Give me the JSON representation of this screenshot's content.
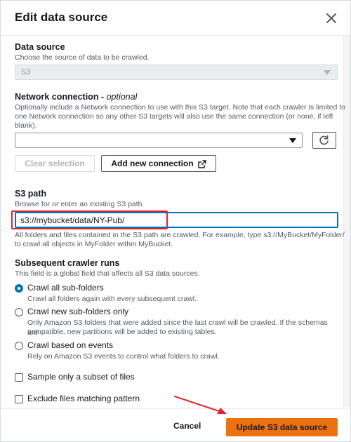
{
  "dialog": {
    "title": "Edit data source"
  },
  "data_source": {
    "label": "Data source",
    "description": "Choose the source of data to be crawled.",
    "value": "S3"
  },
  "network": {
    "label": "Network connection - ",
    "label_optional": "optional",
    "description_1": "Optionally include a Network connection to use with this S3 target. Note that each crawler is limited to",
    "description_2": "one Network connection so any other S3 targets will also use the same connection (or none, if left",
    "description_3": "blank).",
    "value": "",
    "clear_label": "Clear selection",
    "add_label": "Add new connection"
  },
  "s3_path": {
    "label": "S3 path",
    "description": "Browse for or enter an existing S3 path.",
    "value": "s3://mybucket/data/NY-Pub/",
    "help_1": "All folders and files contained in the S3 path are crawled. For example, type s3://MyBucket/MyFolder/",
    "help_2": "to crawl all objects in MyFolder within MyBucket."
  },
  "subsequent": {
    "label": "Subsequent crawler runs",
    "description": "This field is a global field that affects all S3 data sources.",
    "options": [
      {
        "label": "Crawl all sub-folders",
        "desc_1": "Crawl all folders again with every subsequent crawl.",
        "desc_2": "",
        "selected": true
      },
      {
        "label": "Crawl new sub-folders only",
        "desc_1": "Only Amazon S3 folders that were added since the last crawl will be crawled. If the schemas are",
        "desc_2": "compatible, new partitions will be added to existing tables.",
        "selected": false
      },
      {
        "label": "Crawl based on events",
        "desc_1": "Rely on Amazon S3 events to control what folders to crawl.",
        "desc_2": "",
        "selected": false
      }
    ]
  },
  "checkboxes": [
    {
      "label": "Sample only a subset of files",
      "checked": false
    },
    {
      "label": "Exclude files matching pattern",
      "checked": false
    }
  ],
  "footer": {
    "cancel_label": "Cancel",
    "submit_label": "Update S3 data source"
  },
  "colors": {
    "accent": "#0073bb",
    "primary_button": "#ec7211",
    "annotation": "#e0242b"
  }
}
